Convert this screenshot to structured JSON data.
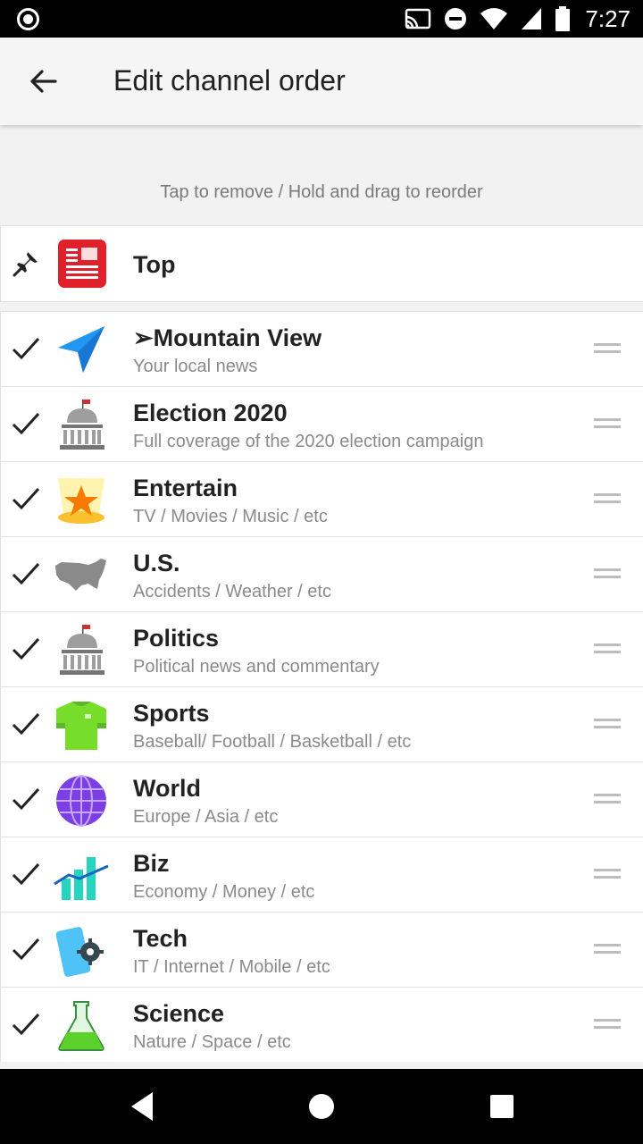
{
  "status_bar": {
    "time": "7:27",
    "icons": [
      "record-icon",
      "cast-icon",
      "do-not-disturb-icon",
      "wifi-icon",
      "signal-icon",
      "battery-icon"
    ]
  },
  "app_bar": {
    "title": "Edit channel order",
    "back_icon": "back-arrow-icon"
  },
  "hint": "Tap to remove / Hold and drag to reorder",
  "pinned": {
    "label": "Top",
    "icon": "newspaper-icon",
    "accent": "#e0202a"
  },
  "channels": [
    {
      "name": "➢Mountain View",
      "subtitle": "Your local news",
      "icon": "location-arrow-icon"
    },
    {
      "name": "Election 2020",
      "subtitle": "Full coverage of the 2020 election campaign",
      "icon": "capitol-icon"
    },
    {
      "name": "Entertain",
      "subtitle": "TV / Movies / Music / etc",
      "icon": "star-spotlight-icon"
    },
    {
      "name": "U.S.",
      "subtitle": "Accidents / Weather / etc",
      "icon": "us-map-icon"
    },
    {
      "name": "Politics",
      "subtitle": "Political news and commentary",
      "icon": "capitol-icon"
    },
    {
      "name": "Sports",
      "subtitle": "Baseball/ Football / Basketball / etc",
      "icon": "jersey-icon"
    },
    {
      "name": "World",
      "subtitle": "Europe / Asia / etc",
      "icon": "globe-icon"
    },
    {
      "name": "Biz",
      "subtitle": "Economy / Money / etc",
      "icon": "bar-chart-icon"
    },
    {
      "name": "Tech",
      "subtitle": "IT / Internet / Mobile / etc",
      "icon": "phone-gear-icon"
    },
    {
      "name": "Science",
      "subtitle": "Nature / Space / etc",
      "icon": "flask-icon"
    }
  ],
  "nav_bar": {
    "buttons": [
      "back-triangle-icon",
      "home-circle-icon",
      "recents-square-icon"
    ]
  }
}
